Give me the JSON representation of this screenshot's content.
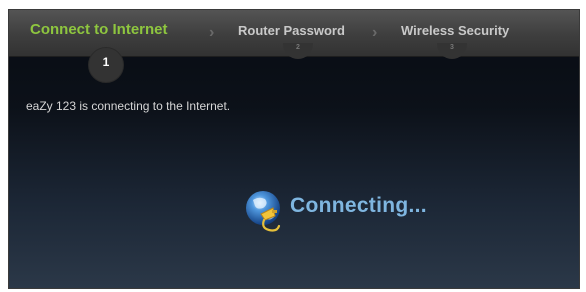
{
  "wizard": {
    "steps": [
      {
        "label": "Connect to Internet",
        "number": "1",
        "state": "active"
      },
      {
        "label": "Router Password",
        "number": "2",
        "state": "inactive"
      },
      {
        "label": "Wireless Security",
        "number": "3",
        "state": "inactive"
      }
    ],
    "separator_icon": "chevron-right-icon"
  },
  "main": {
    "message": "eaZy 123 is connecting to the Internet.",
    "status_icon": "globe-plug-icon",
    "status_text": "Connecting..."
  },
  "colors": {
    "active_step": "#8ec63f",
    "inactive_step": "#c9c9c9",
    "status_text": "#7fb6e0",
    "background_top": "#070b12",
    "background_bottom": "#2b3848"
  }
}
